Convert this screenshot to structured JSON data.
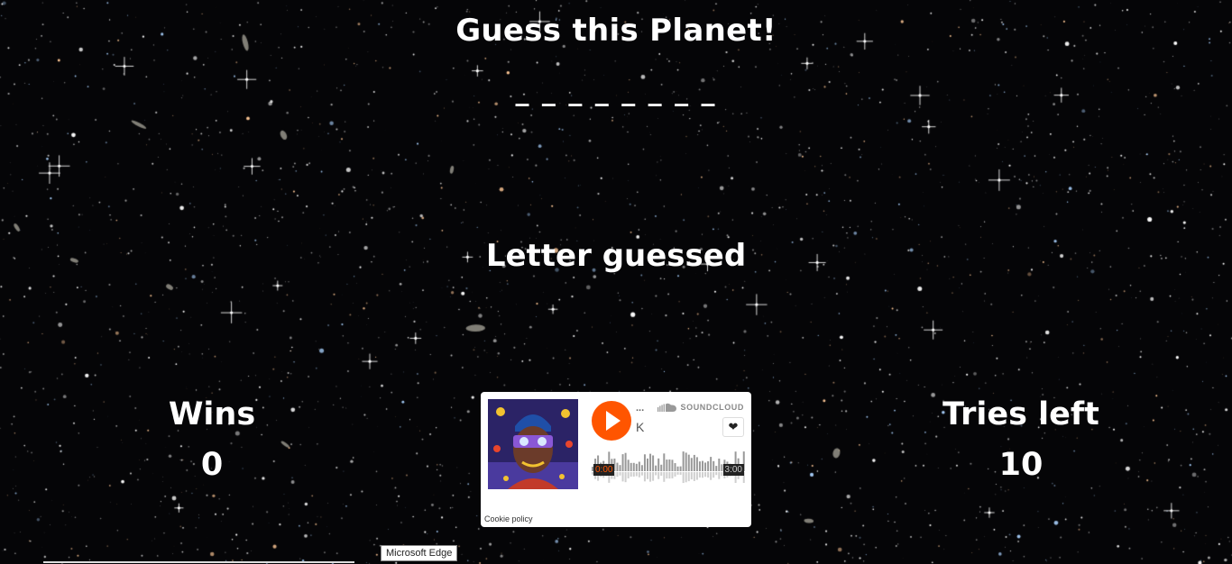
{
  "game": {
    "title": "Guess this Planet!",
    "word_display": "_ _ _ _ _ _ _ _",
    "guessed_label": "Letter guessed",
    "guessed_letters": "",
    "wins_label": "Wins",
    "wins_value": "0",
    "tries_label": "Tries left",
    "tries_value": "10"
  },
  "player": {
    "username": "...",
    "track": "K",
    "brand": "SOUNDCLOUD",
    "time_current": "0:00",
    "time_total": "3:00",
    "progress": 0,
    "cookie_label": "Cookie policy",
    "accent_color": "#ff5500"
  },
  "tooltip": {
    "text": "Microsoft Edge"
  },
  "icons": {
    "play": "play-icon",
    "like": "heart-icon",
    "brand": "soundcloud-icon"
  }
}
